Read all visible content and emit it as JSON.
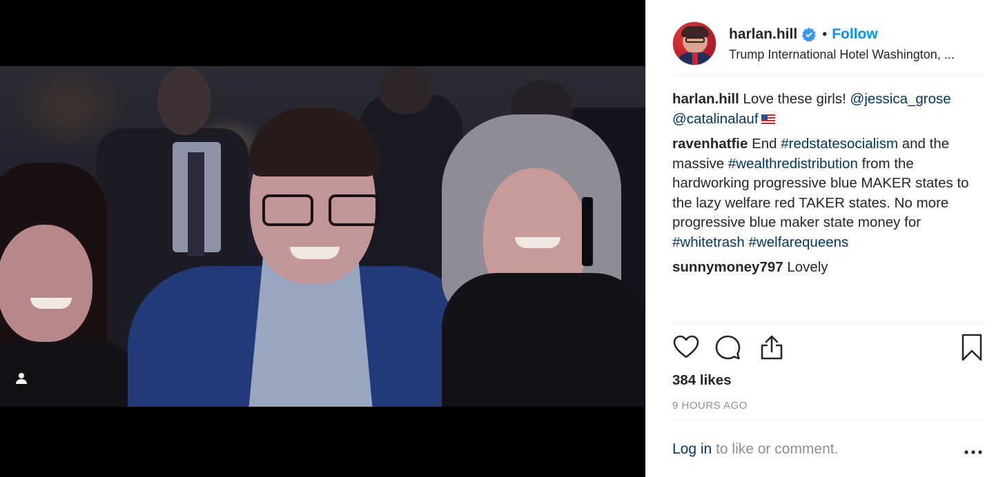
{
  "post": {
    "username": "harlan.hill",
    "follow_label": "Follow",
    "separator": "•",
    "location": "Trump International Hotel Washington, ...",
    "caption": {
      "username": "harlan.hill",
      "text": "Love these girls!",
      "mention1": "@jessica_grose",
      "mention2": "@catalinalauf",
      "emoji": "flag-us-icon"
    },
    "comments": [
      {
        "username": "ravenhatfie",
        "parts": {
          "t1": "End",
          "h1": "#redstatesocialism",
          "t2": "and the massive",
          "h2": "#wealthredistribution",
          "t3": "from the hardworking progressive blue MAKER states to the lazy welfare red TAKER states. No more progressive blue maker state money for",
          "h3": "#whitetrash",
          "h4": "#welfarequeens"
        }
      },
      {
        "username": "sunnymoney797",
        "text": "Lovely"
      }
    ],
    "likes": "384 likes",
    "timestamp": "9 HOURS AGO",
    "login": {
      "link": "Log in",
      "rest": "to like or comment."
    },
    "icons": {
      "like": "heart-icon",
      "comment": "comment-icon",
      "share": "share-icon",
      "save": "bookmark-icon",
      "more": "more-dots-icon",
      "tags": "user-tag-icon",
      "verified": "verified-badge-icon"
    },
    "colors": {
      "follow": "#0095f6",
      "link": "#00376b",
      "muted": "#8e8e8e",
      "text": "#262626"
    }
  }
}
